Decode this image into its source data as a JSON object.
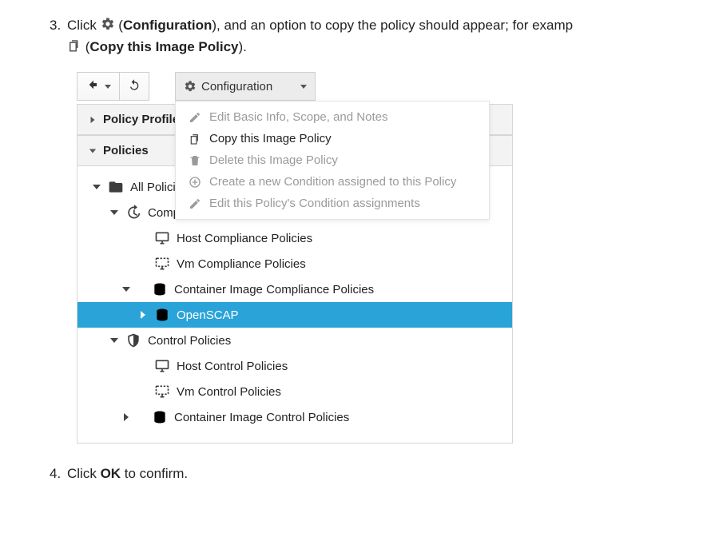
{
  "doc": {
    "step3_number": "3.",
    "step3_a": "Click ",
    "step3_b": " (",
    "step3_configuration": "Configuration",
    "step3_c": "), and an option to copy the policy should appear; for examp",
    "step3_d": " (",
    "step3_copy_policy": "Copy this Image Policy",
    "step3_e": ").",
    "step4_number": "4.",
    "step4_a": "Click ",
    "step4_ok": "OK",
    "step4_b": " to confirm."
  },
  "toolbar": {
    "configuration_label": "Configuration"
  },
  "menu": {
    "edit_basic": "Edit Basic Info, Scope, and Notes",
    "copy_policy": "Copy this Image Policy",
    "delete_policy": "Delete this Image Policy",
    "create_condition": "Create a new Condition assigned to this Policy",
    "edit_conditions": "Edit this Policy's Condition assignments"
  },
  "accordion": {
    "policy_profiles": "Policy Profiles",
    "policies": "Policies"
  },
  "tree": {
    "all_policies": "All Policies",
    "compliance_policies": "Compliance Policies",
    "compliance_short": "Complia",
    "host_compliance": "Host Compliance Policies",
    "vm_compliance": "Vm Compliance Policies",
    "container_compliance": "Container Image Compliance Policies",
    "openscap": "OpenSCAP",
    "control_policies": "Control Policies",
    "host_control": "Host Control Policies",
    "vm_control": "Vm Control Policies",
    "container_control": "Container Image Control Policies"
  },
  "colors": {
    "selection": "#2aa3d8",
    "container_teal": "#29abb9"
  }
}
